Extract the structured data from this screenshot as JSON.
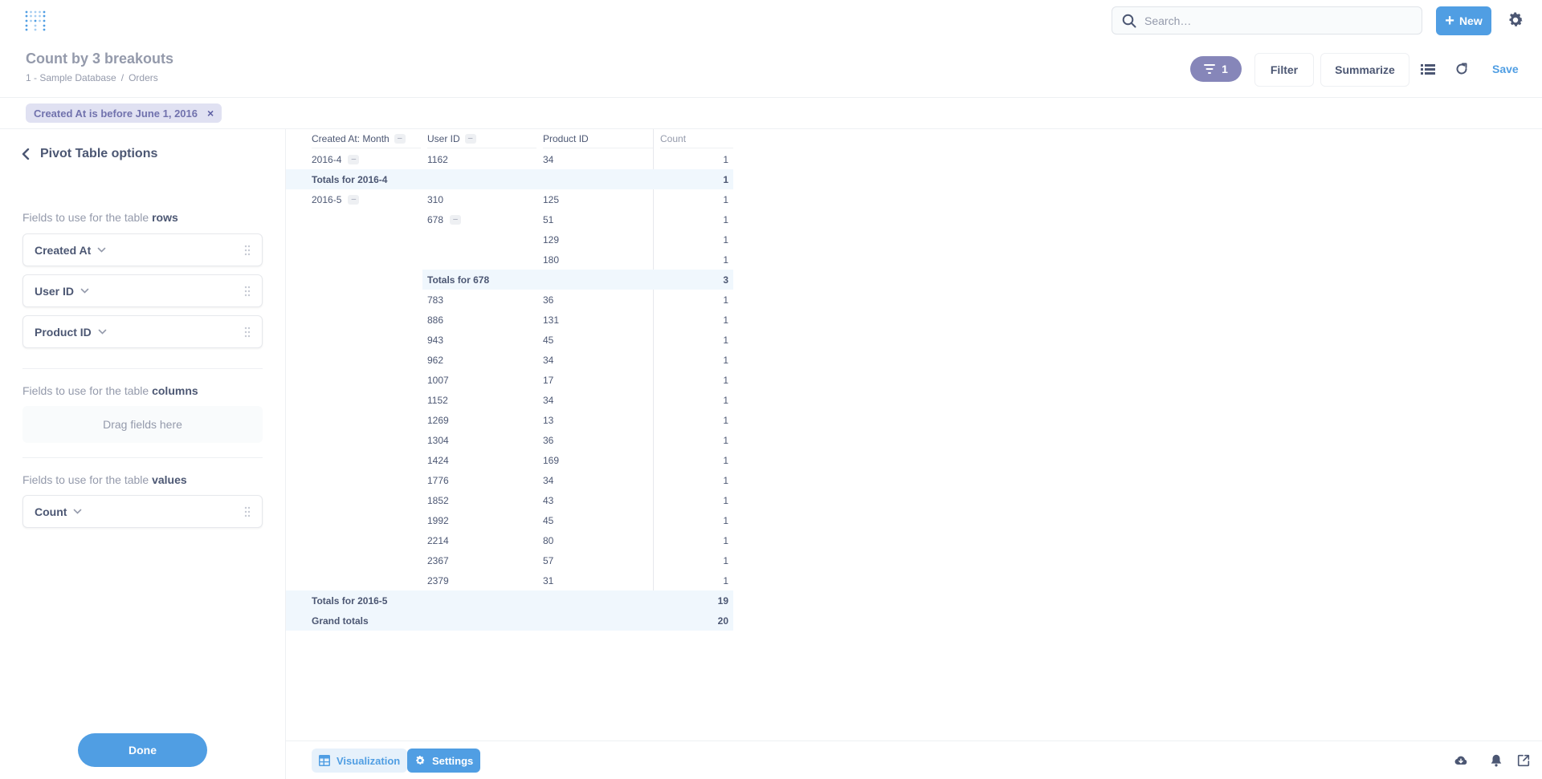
{
  "nav": {
    "search_placeholder": "Search…",
    "new_label": "New"
  },
  "header": {
    "title": "Count by 3 breakouts",
    "breadcrumb": [
      "1 - Sample Database",
      "/",
      "Orders"
    ],
    "filter_count": "1",
    "filter_label": "Filter",
    "summarize_label": "Summarize",
    "save_label": "Save"
  },
  "filters": [
    {
      "label": "Created At is before June 1, 2016",
      "remove": "×"
    }
  ],
  "sidebar": {
    "title": "Pivot Table options",
    "rows_label": "Fields to use for the table",
    "rows_bold": "rows",
    "row_fields": [
      "Created At",
      "User ID",
      "Product ID"
    ],
    "columns_label": "Fields to use for the table",
    "columns_bold": "columns",
    "columns_placeholder": "Drag fields here",
    "values_label": "Fields to use for the table",
    "values_bold": "values",
    "value_fields": [
      "Count"
    ],
    "done_label": "Done"
  },
  "pivot": {
    "headers": [
      "Created At: Month",
      "User ID",
      "Product ID",
      "Count"
    ],
    "collapse_glyph": "–",
    "rows": [
      {
        "type": "data",
        "month": "2016-4",
        "month_collapse": true,
        "user": "1162",
        "product": "34",
        "count": "1"
      },
      {
        "type": "total",
        "label": "Totals for 2016-4",
        "level": 0,
        "count": "1"
      },
      {
        "type": "data",
        "month": "2016-5",
        "month_collapse": true,
        "user": "310",
        "product": "125",
        "count": "1"
      },
      {
        "type": "data",
        "user": "678",
        "user_collapse": true,
        "product": "51",
        "count": "1"
      },
      {
        "type": "data",
        "product": "129",
        "count": "1"
      },
      {
        "type": "data",
        "product": "180",
        "count": "1"
      },
      {
        "type": "total",
        "label": "Totals for 678",
        "level": 1,
        "count": "3"
      },
      {
        "type": "data",
        "user": "783",
        "product": "36",
        "count": "1"
      },
      {
        "type": "data",
        "user": "886",
        "product": "131",
        "count": "1"
      },
      {
        "type": "data",
        "user": "943",
        "product": "45",
        "count": "1"
      },
      {
        "type": "data",
        "user": "962",
        "product": "34",
        "count": "1"
      },
      {
        "type": "data",
        "user": "1007",
        "product": "17",
        "count": "1"
      },
      {
        "type": "data",
        "user": "1152",
        "product": "34",
        "count": "1"
      },
      {
        "type": "data",
        "user": "1269",
        "product": "13",
        "count": "1"
      },
      {
        "type": "data",
        "user": "1304",
        "product": "36",
        "count": "1"
      },
      {
        "type": "data",
        "user": "1424",
        "product": "169",
        "count": "1"
      },
      {
        "type": "data",
        "user": "1776",
        "product": "34",
        "count": "1"
      },
      {
        "type": "data",
        "user": "1852",
        "product": "43",
        "count": "1"
      },
      {
        "type": "data",
        "user": "1992",
        "product": "45",
        "count": "1"
      },
      {
        "type": "data",
        "user": "2214",
        "product": "80",
        "count": "1"
      },
      {
        "type": "data",
        "user": "2367",
        "product": "57",
        "count": "1"
      },
      {
        "type": "data",
        "user": "2379",
        "product": "31",
        "count": "1"
      },
      {
        "type": "total",
        "label": "Totals for 2016-5",
        "level": 0,
        "count": "19"
      },
      {
        "type": "total",
        "label": "Grand totals",
        "level": 0,
        "count": "20"
      }
    ]
  },
  "footer": {
    "visualization_label": "Visualization",
    "settings_label": "Settings"
  },
  "icons": {
    "logo": "metabase-logo-icon",
    "search": "search-icon",
    "plus": "plus-icon",
    "gear": "gear-icon",
    "filter": "filter-icon",
    "table_view": "table-view-icon",
    "refresh": "refresh-icon",
    "chevron_left": "chevron-left-icon",
    "chevron_down": "chevron-down-icon",
    "grip": "drag-grip-icon",
    "download": "download-icon",
    "bell": "bell-icon",
    "share": "share-icon"
  },
  "colors": {
    "brand": "#509ee3",
    "filter": "#7172ad",
    "text": "#4c5773",
    "muted": "#949aab",
    "total_row": "#f0f7fd"
  }
}
